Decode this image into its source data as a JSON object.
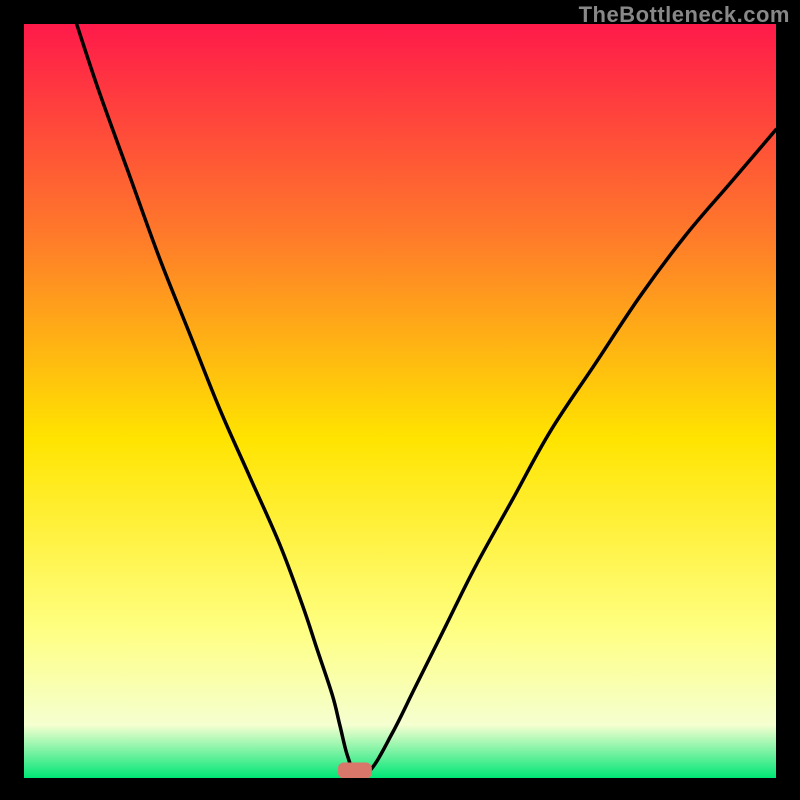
{
  "watermark": "TheBottleneck.com",
  "chart_data": {
    "type": "line",
    "title": "",
    "xlabel": "",
    "ylabel": "",
    "xlim": [
      0,
      100
    ],
    "ylim": [
      0,
      100
    ],
    "grid": false,
    "legend": false,
    "annotations": [],
    "background_gradient": {
      "top": "#ff1a4a",
      "mid_upper": "#ff7a2a",
      "mid": "#ffe400",
      "mid_lower": "#ffff80",
      "low": "#f5ffd0",
      "bottom": "#00e676"
    },
    "marker": {
      "x": 44,
      "y": 1,
      "color": "#d9776b",
      "shape": "rounded-rect"
    },
    "series": [
      {
        "name": "curve",
        "x": [
          7,
          10,
          14,
          18,
          22,
          26,
          30,
          34,
          37,
          39,
          41,
          42,
          43,
          44,
          46,
          49,
          52,
          56,
          60,
          65,
          70,
          76,
          82,
          88,
          94,
          100
        ],
        "y": [
          100,
          91,
          80,
          69,
          59,
          49,
          40,
          31,
          23,
          17,
          11,
          7,
          3,
          1,
          1,
          6,
          12,
          20,
          28,
          37,
          46,
          55,
          64,
          72,
          79,
          86
        ]
      }
    ]
  }
}
